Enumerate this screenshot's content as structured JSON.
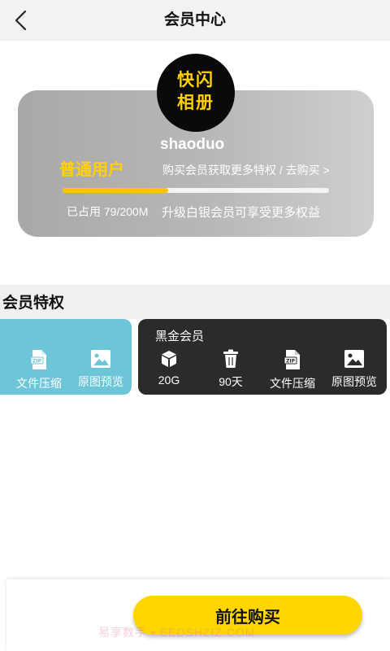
{
  "header": {
    "title": "会员中心",
    "back_icon": "chevron-left-icon"
  },
  "profile": {
    "logo_line1": "快闪",
    "logo_line2": "相册",
    "username": "shaoduo",
    "tier": "普通用户",
    "buy_link": "购买会员获取更多特权 / 去购买 >",
    "usage_text": "已占用 79/200M",
    "usage_fraction": 0.395,
    "upgrade_tip": "升级白银会员可享受更多权益"
  },
  "privileges": {
    "title": "会员特权",
    "basic": {
      "items": [
        {
          "icon": "zip-file-icon",
          "label": "文件压缩"
        },
        {
          "icon": "image-icon",
          "label": "原图预览"
        }
      ]
    },
    "black": {
      "title": "黑金会员",
      "items": [
        {
          "icon": "cube-icon",
          "label": "20G"
        },
        {
          "icon": "trash-icon",
          "label": "90天"
        },
        {
          "icon": "zip-file-icon",
          "label": "文件压缩"
        },
        {
          "icon": "image-icon",
          "label": "原图预览"
        }
      ]
    }
  },
  "footer": {
    "buy_button": "前往购买"
  },
  "watermark": "易享数手 • EEDSHZIZ.COM",
  "colors": {
    "accent": "#ffd600",
    "basic_card": "#6cc6d7",
    "black_card": "#2b2b2b",
    "card_gray": "#b0b0b0"
  }
}
